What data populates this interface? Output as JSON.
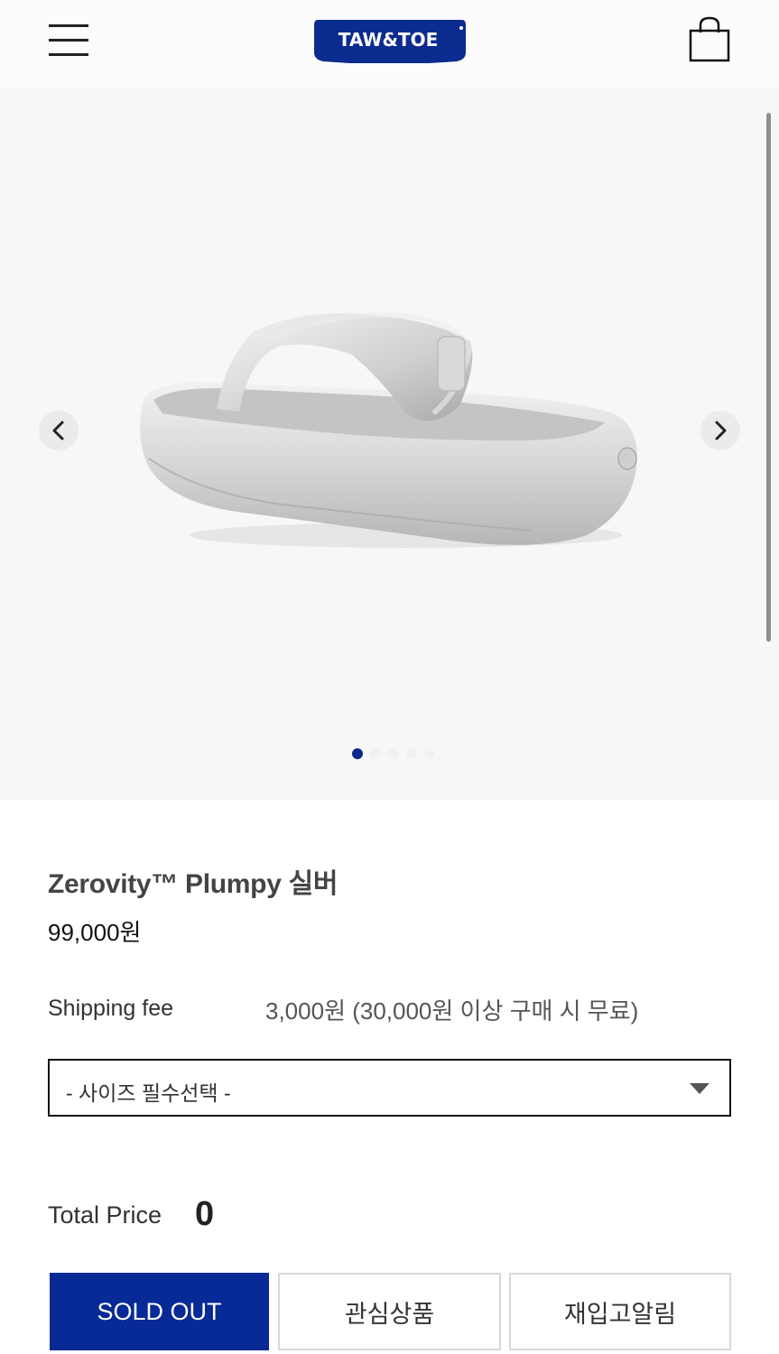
{
  "header": {
    "logo_text": "TAW&TOE",
    "brand_color": "#0c2b8f",
    "menu_icon": "hamburger-menu-icon",
    "cart_icon": "shopping-bag-icon"
  },
  "gallery": {
    "prev_icon": "chevron-left-icon",
    "next_icon": "chevron-right-icon",
    "slide_count": 5,
    "active_slide": 1,
    "active_dot_color": "#0a2a8a"
  },
  "product": {
    "name": "Zerovity™ Plumpy 실버",
    "price": "99,000원"
  },
  "shipping": {
    "label": "Shipping fee",
    "value": "3,000원 (30,000원 이상 구매 시 무료)"
  },
  "size_select": {
    "selected": "- 사이즈 필수선택 -"
  },
  "total": {
    "label": "Total Price",
    "value": "0"
  },
  "actions": {
    "sold_out": "SOLD OUT",
    "wishlist": "관심상품",
    "restock": "재입고알림"
  }
}
